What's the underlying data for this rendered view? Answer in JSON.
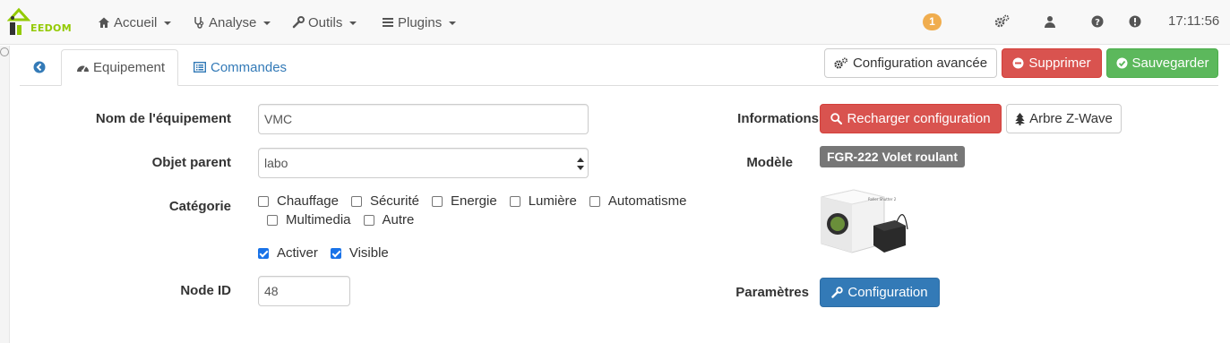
{
  "navbar": {
    "logo_text": "EEDOM",
    "menus": [
      {
        "label": "Accueil",
        "icon": "home-icon"
      },
      {
        "label": "Analyse",
        "icon": "stethoscope-icon"
      },
      {
        "label": "Outils",
        "icon": "wrench-icon"
      },
      {
        "label": "Plugins",
        "icon": "tasks-icon"
      }
    ],
    "notification_count": "1",
    "time": "17:11:56",
    "colors": {
      "accent": "#93ca02",
      "badge": "#f0ad4e"
    }
  },
  "tabs": {
    "equipement": "Equipement",
    "commandes": "Commandes"
  },
  "actions": {
    "config_avancee": "Configuration avancée",
    "supprimer": "Supprimer",
    "sauvegarder": "Sauvegarder"
  },
  "form": {
    "nom_label": "Nom de l'équipement",
    "nom_value": "VMC",
    "parent_label": "Objet parent",
    "parent_value": "labo",
    "categorie_label": "Catégorie",
    "categories": [
      {
        "label": "Chauffage",
        "checked": false
      },
      {
        "label": "Sécurité",
        "checked": false
      },
      {
        "label": "Energie",
        "checked": false
      },
      {
        "label": "Lumière",
        "checked": false
      },
      {
        "label": "Automatisme",
        "checked": false
      },
      {
        "label": "Multimedia",
        "checked": false
      },
      {
        "label": "Autre",
        "checked": false
      }
    ],
    "activer_label": "Activer",
    "activer_checked": true,
    "visible_label": "Visible",
    "visible_checked": true,
    "node_label": "Node ID",
    "node_value": "48"
  },
  "info": {
    "informations_label": "Informations",
    "recharger": "Recharger configuration",
    "arbre": "Arbre Z-Wave",
    "modele_label": "Modèle",
    "modele_value": "FGR-222 Volet roulant",
    "parametres_label": "Paramètres",
    "configuration": "Configuration"
  }
}
